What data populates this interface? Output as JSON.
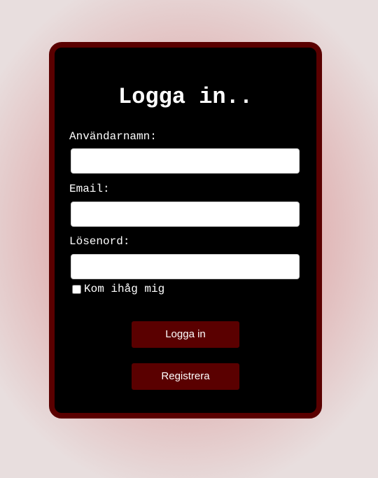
{
  "colors": {
    "card_background": "#000000",
    "card_border": "#5a0000",
    "button_background": "#5a0000",
    "text": "#ffffff",
    "page_background": "#e8dede",
    "page_glow": "#d68f8f"
  },
  "login_form": {
    "title": "Logga in..",
    "fields": {
      "username": {
        "label": "Användarnamn:",
        "value": "",
        "placeholder": ""
      },
      "email": {
        "label": "Email:",
        "value": "",
        "placeholder": ""
      },
      "password": {
        "label": "Lösenord:",
        "value": "",
        "placeholder": ""
      }
    },
    "remember_me": {
      "label": "Kom ihåg mig",
      "checked": false
    },
    "login_button": "Logga in",
    "register_button": "Registrera"
  }
}
